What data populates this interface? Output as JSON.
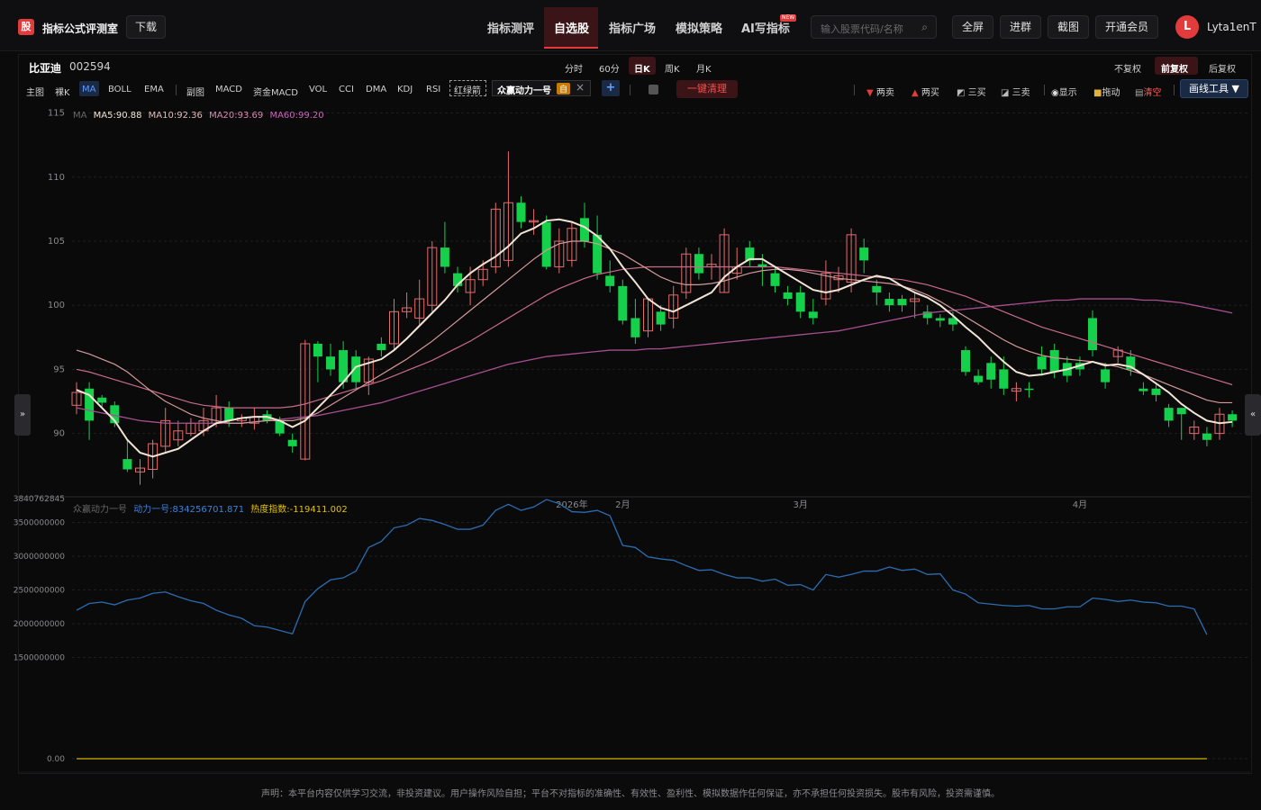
{
  "header": {
    "logo_glyph": "股",
    "logo_title": "指标公式评测室",
    "download": "下载",
    "nav": [
      "指标测评",
      "自选股",
      "指标广场",
      "模拟策略",
      "AI写指标"
    ],
    "nav_active": "自选股",
    "new_badge": "NEW",
    "search_placeholder": "输入股票代码/名称",
    "buttons": [
      "全屏",
      "进群",
      "截图",
      "开通会员"
    ],
    "avatar_letter": "L",
    "username": "Lyta1enT"
  },
  "stock": {
    "name": "比亚迪",
    "code": "002594"
  },
  "periods": [
    "分时",
    "60分",
    "日K",
    "周K",
    "月K"
  ],
  "period_active": "日K",
  "adjust": [
    "不复权",
    "前复权",
    "后复权"
  ],
  "adjust_active": "前复权",
  "indicator_bar": {
    "main_label": "主图",
    "main_items": [
      "裸K",
      "MA",
      "BOLL",
      "EMA"
    ],
    "active_item": "MA",
    "sub_label": "副图",
    "sub_items": [
      "MACD",
      "资金MACD",
      "VOL",
      "CCI",
      "DMA",
      "KDJ",
      "RSI"
    ],
    "hongluzhan": "红绿箭",
    "custom_indicator": "众赢动力一号",
    "custom_tag": "自",
    "clean_button": "一键清理"
  },
  "tools": {
    "items": [
      {
        "label": "两卖",
        "icon": "down-triangle-icon"
      },
      {
        "label": "两买",
        "icon": "up-triangle-icon"
      },
      {
        "label": "三买",
        "icon": "flag-icon"
      },
      {
        "label": "三卖",
        "icon": "flag-icon"
      },
      {
        "label": "显示",
        "icon": "eye-icon"
      },
      {
        "label": "拖动",
        "icon": "lock-icon"
      },
      {
        "label": "清空",
        "icon": "trash-icon"
      }
    ],
    "draw_button": "画线工具 ▼"
  },
  "ma_legend": {
    "label": "MA",
    "ma5": "MA5:90.88",
    "ma10": "MA10:92.36",
    "ma20": "MA20:93.69",
    "ma60": "MA60:99.20"
  },
  "sub_legend": {
    "label": "众赢动力一号",
    "line": "动力一号:834256701.871",
    "heat": "热度指数:-119411.002"
  },
  "chart_data": [
    {
      "type": "candlestick",
      "title": "",
      "y_ticks": [
        115,
        110,
        105,
        100,
        95,
        90
      ],
      "ylim": [
        85.2,
        115.6
      ],
      "x_labels": [
        {
          "label": "2026年",
          "index": 39
        },
        {
          "label": "2月",
          "index": 43
        },
        {
          "label": "3月",
          "index": 57
        },
        {
          "label": "4月",
          "index": 79
        }
      ],
      "candles": [
        [
          92.2,
          93.2,
          94.0,
          91.5
        ],
        [
          93.5,
          91.0,
          94.0,
          89.5
        ],
        [
          92.8,
          92.4,
          93.0,
          92.0
        ],
        [
          92.2,
          90.8,
          92.5,
          90.5
        ],
        [
          88.0,
          87.2,
          89.5,
          87.0
        ],
        [
          87.0,
          87.3,
          88.0,
          86.0
        ],
        [
          87.2,
          89.2,
          89.5,
          86.5
        ],
        [
          89.0,
          91.0,
          92.0,
          88.5
        ],
        [
          89.5,
          90.2,
          91.0,
          89.0
        ],
        [
          90.0,
          90.8,
          91.2,
          89.8
        ],
        [
          90.2,
          91.0,
          92.0,
          89.8
        ],
        [
          90.8,
          92.0,
          93.0,
          90.5
        ],
        [
          92.0,
          91.0,
          92.5,
          90.5
        ],
        [
          91.0,
          91.2,
          91.5,
          90.5
        ],
        [
          90.8,
          91.3,
          92.0,
          90.3
        ],
        [
          91.5,
          91.0,
          91.8,
          90.8
        ],
        [
          91.0,
          90.0,
          91.3,
          89.8
        ],
        [
          89.5,
          89.0,
          90.0,
          88.5
        ],
        [
          88.0,
          97.0,
          97.3,
          87.9
        ],
        [
          97.0,
          96.0,
          97.2,
          94.0
        ],
        [
          96.0,
          95.0,
          97.0,
          94.5
        ],
        [
          96.5,
          94.0,
          97.2,
          93.5
        ],
        [
          96.0,
          94.0,
          96.5,
          93.5
        ],
        [
          94.0,
          95.8,
          96.0,
          93.0
        ],
        [
          97.0,
          96.5,
          97.5,
          96.0
        ],
        [
          97.0,
          99.5,
          100.5,
          96.5
        ],
        [
          99.5,
          99.8,
          101.0,
          99.0
        ],
        [
          99.0,
          100.5,
          102.0,
          98.5
        ],
        [
          100.0,
          104.5,
          105.0,
          99.5
        ],
        [
          104.5,
          103.0,
          106.5,
          102.5
        ],
        [
          102.5,
          101.5,
          103.0,
          101.0
        ],
        [
          101.0,
          102.0,
          103.0,
          100.0
        ],
        [
          102.0,
          102.8,
          103.5,
          101.5
        ],
        [
          103.0,
          107.5,
          108.0,
          102.5
        ],
        [
          103.5,
          108.0,
          112.0,
          103.0
        ],
        [
          108.0,
          106.5,
          108.5,
          106.0
        ],
        [
          106.5,
          106.6,
          107.5,
          105.5
        ],
        [
          106.5,
          103.0,
          107.0,
          102.8
        ],
        [
          103.0,
          105.0,
          106.0,
          102.5
        ],
        [
          103.5,
          106.0,
          106.5,
          103.0
        ],
        [
          106.8,
          105.0,
          108.0,
          104.5
        ],
        [
          105.5,
          102.5,
          107.0,
          102.0
        ],
        [
          102.3,
          101.5,
          103.5,
          101.0
        ],
        [
          101.5,
          98.8,
          102.0,
          98.5
        ],
        [
          99.0,
          97.5,
          100.5,
          97.0
        ],
        [
          98.0,
          100.5,
          100.5,
          97.5
        ],
        [
          99.5,
          98.5,
          100.0,
          98.0
        ],
        [
          99.0,
          100.8,
          101.5,
          98.2
        ],
        [
          101.0,
          104.0,
          104.5,
          100.5
        ],
        [
          104.0,
          102.5,
          104.5,
          102.0
        ],
        [
          103.0,
          103.2,
          104.0,
          102.0
        ],
        [
          101.0,
          105.5,
          106.0,
          101.0
        ],
        [
          102.5,
          103.0,
          104.5,
          102.0
        ],
        [
          104.5,
          103.5,
          105.0,
          103.0
        ],
        [
          103.2,
          103.0,
          104.0,
          101.5
        ],
        [
          102.5,
          101.5,
          103.0,
          101.0
        ],
        [
          101.0,
          100.5,
          101.5,
          100.0
        ],
        [
          101.0,
          99.5,
          101.5,
          99.0
        ],
        [
          99.5,
          99.0,
          100.5,
          98.5
        ],
        [
          100.5,
          102.5,
          103.5,
          100.0
        ],
        [
          102.0,
          102.3,
          103.0,
          101.0
        ],
        [
          101.8,
          105.5,
          106.0,
          101.0
        ],
        [
          104.5,
          103.5,
          105.2,
          102.5
        ],
        [
          101.5,
          101.0,
          102.0,
          100.0
        ],
        [
          100.5,
          100.0,
          101.0,
          99.5
        ],
        [
          100.5,
          100.0,
          100.8,
          99.5
        ],
        [
          100.3,
          100.5,
          101.0,
          99.0
        ],
        [
          99.5,
          99.0,
          100.0,
          98.5
        ],
        [
          99.0,
          98.8,
          99.3,
          98.3
        ],
        [
          99.0,
          98.5,
          99.5,
          98.0
        ],
        [
          96.5,
          94.8,
          96.8,
          94.5
        ],
        [
          94.5,
          94.0,
          95.0,
          93.8
        ],
        [
          95.5,
          94.2,
          96.0,
          93.5
        ],
        [
          95.0,
          93.5,
          96.0,
          93.0
        ],
        [
          93.3,
          93.5,
          94.0,
          92.5
        ],
        [
          93.5,
          93.4,
          94.0,
          92.8
        ],
        [
          96.0,
          95.0,
          96.8,
          94.5
        ],
        [
          96.5,
          94.8,
          97.0,
          94.3
        ],
        [
          95.5,
          94.5,
          96.0,
          94.0
        ],
        [
          95.5,
          95.0,
          96.0,
          94.5
        ],
        [
          99.0,
          96.5,
          99.6,
          96.0
        ],
        [
          95.0,
          94.0,
          95.5,
          93.5
        ],
        [
          96.0,
          96.5,
          96.8,
          95.5
        ],
        [
          96.0,
          95.0,
          96.5,
          94.5
        ],
        [
          93.5,
          93.3,
          94.0,
          93.0
        ],
        [
          93.5,
          93.0,
          93.8,
          92.5
        ],
        [
          92.0,
          91.0,
          92.3,
          90.5
        ],
        [
          92.0,
          91.5,
          92.0,
          89.5
        ],
        [
          90.0,
          90.5,
          91.0,
          89.5
        ],
        [
          90.0,
          89.5,
          90.5,
          89.0
        ],
        [
          90.0,
          91.5,
          92.0,
          89.5
        ],
        [
          91.5,
          91.0,
          91.8,
          90.5
        ]
      ],
      "ma5": [
        93.4,
        93.0,
        92.0,
        91.0,
        89.5,
        88.5,
        88.2,
        88.5,
        88.8,
        89.5,
        90.2,
        90.8,
        91.0,
        91.2,
        91.3,
        91.3,
        91.0,
        90.5,
        91.0,
        92.0,
        93.0,
        94.0,
        95.2,
        95.5,
        95.8,
        96.5,
        97.4,
        98.4,
        99.4,
        100.4,
        101.6,
        102.5,
        103.2,
        103.8,
        104.6,
        105.6,
        106.0,
        106.6,
        106.7,
        106.5,
        106.1,
        105.4,
        104.4,
        103.0,
        101.8,
        100.5,
        99.8,
        99.5,
        100.0,
        100.5,
        101.0,
        102.2,
        103.0,
        103.6,
        103.6,
        103.0,
        102.4,
        101.8,
        101.2,
        101.0,
        101.2,
        101.6,
        102.0,
        102.3,
        102.1,
        101.5,
        101.0,
        100.6,
        100.0,
        99.2,
        98.3,
        97.5,
        96.5,
        95.6,
        94.8,
        94.5,
        94.6,
        94.8,
        95.0,
        95.3,
        95.6,
        95.3,
        95.4,
        95.2,
        94.6,
        93.9,
        93.2,
        92.3,
        91.6,
        91.0,
        90.8,
        90.9
      ],
      "ma10": [
        96.5,
        96.2,
        95.8,
        95.4,
        94.8,
        94.0,
        93.2,
        92.5,
        92.0,
        91.5,
        91.2,
        91.0,
        90.8,
        90.8,
        90.9,
        91.0,
        91.0,
        91.0,
        91.2,
        91.6,
        92.2,
        92.8,
        93.4,
        94.0,
        94.6,
        95.2,
        95.8,
        96.5,
        97.2,
        98.0,
        98.8,
        99.6,
        100.4,
        101.2,
        102.0,
        102.8,
        103.6,
        104.3,
        104.8,
        105.0,
        105.0,
        104.8,
        104.4,
        104.0,
        103.4,
        102.8,
        102.2,
        101.8,
        101.6,
        101.6,
        101.7,
        101.9,
        102.2,
        102.5,
        102.7,
        102.8,
        102.8,
        102.7,
        102.5,
        102.3,
        102.1,
        102.0,
        101.9,
        101.8,
        101.7,
        101.5,
        101.2,
        100.8,
        100.3,
        99.7,
        99.1,
        98.5,
        97.9,
        97.3,
        96.8,
        96.4,
        96.1,
        95.9,
        95.8,
        95.7,
        95.6,
        95.4,
        95.2,
        94.9,
        94.6,
        94.2,
        93.8,
        93.4,
        93.0,
        92.6,
        92.4,
        92.4
      ],
      "ma20": [
        95.0,
        94.8,
        94.5,
        94.2,
        93.9,
        93.6,
        93.3,
        93.0,
        92.7,
        92.4,
        92.2,
        92.1,
        92.0,
        92.0,
        92.0,
        92.0,
        92.0,
        92.1,
        92.3,
        92.6,
        92.9,
        93.2,
        93.5,
        93.8,
        94.1,
        94.5,
        94.9,
        95.3,
        95.7,
        96.2,
        96.7,
        97.2,
        97.8,
        98.4,
        99.0,
        99.6,
        100.2,
        100.8,
        101.3,
        101.7,
        102.1,
        102.4,
        102.6,
        102.8,
        102.9,
        103.0,
        103.0,
        103.0,
        103.0,
        103.0,
        103.0,
        103.0,
        103.0,
        103.0,
        103.0,
        103.0,
        102.9,
        102.8,
        102.7,
        102.6,
        102.5,
        102.4,
        102.3,
        102.2,
        102.1,
        102.0,
        101.8,
        101.6,
        101.3,
        101.0,
        100.7,
        100.3,
        99.9,
        99.5,
        99.1,
        98.7,
        98.3,
        98.0,
        97.7,
        97.4,
        97.1,
        96.8,
        96.5,
        96.2,
        95.9,
        95.6,
        95.3,
        95.0,
        94.7,
        94.4,
        94.1,
        93.8
      ],
      "ma60": [
        92.0,
        91.8,
        91.6,
        91.4,
        91.2,
        91.0,
        90.9,
        90.8,
        90.8,
        90.8,
        90.8,
        90.8,
        90.8,
        90.8,
        90.9,
        91.0,
        91.1,
        91.2,
        91.3,
        91.4,
        91.6,
        91.8,
        92.0,
        92.2,
        92.4,
        92.7,
        93.0,
        93.3,
        93.6,
        93.9,
        94.2,
        94.5,
        94.8,
        95.1,
        95.4,
        95.6,
        95.8,
        96.0,
        96.1,
        96.2,
        96.3,
        96.4,
        96.5,
        96.5,
        96.5,
        96.6,
        96.6,
        96.7,
        96.8,
        96.9,
        97.0,
        97.1,
        97.2,
        97.3,
        97.4,
        97.5,
        97.6,
        97.7,
        97.8,
        97.9,
        98.0,
        98.2,
        98.4,
        98.6,
        98.8,
        99.0,
        99.2,
        99.4,
        99.5,
        99.6,
        99.7,
        99.8,
        99.9,
        100.0,
        100.1,
        100.2,
        100.3,
        100.4,
        100.4,
        100.5,
        100.5,
        100.5,
        100.5,
        100.5,
        100.4,
        100.4,
        100.3,
        100.2,
        100.0,
        99.8,
        99.6,
        99.4
      ]
    },
    {
      "type": "line",
      "title": "",
      "y_ticks": [
        "3840762845",
        "3500000000",
        "3000000000",
        "2500000000",
        "2000000000",
        "1500000000",
        "0.00"
      ],
      "ylim": [
        0,
        3840762845
      ],
      "series": [
        {
          "color": "#2b6cb0",
          "values": [
            2200000000,
            2300000000,
            2320000000,
            2280000000,
            2350000000,
            2380000000,
            2450000000,
            2470000000,
            2400000000,
            2340000000,
            2300000000,
            2200000000,
            2130000000,
            2080000000,
            1970000000,
            1950000000,
            1900000000,
            1850000000,
            2330000000,
            2520000000,
            2650000000,
            2680000000,
            2780000000,
            3130000000,
            3220000000,
            3420000000,
            3460000000,
            3560000000,
            3530000000,
            3470000000,
            3400000000,
            3400000000,
            3460000000,
            3680000000,
            3770000000,
            3680000000,
            3730000000,
            3840000000,
            3780000000,
            3660000000,
            3650000000,
            3680000000,
            3600000000,
            3160000000,
            3130000000,
            2990000000,
            2960000000,
            2940000000,
            2860000000,
            2790000000,
            2800000000,
            2730000000,
            2680000000,
            2680000000,
            2630000000,
            2660000000,
            2570000000,
            2580000000,
            2500000000,
            2730000000,
            2690000000,
            2730000000,
            2780000000,
            2780000000,
            2840000000,
            2790000000,
            2810000000,
            2730000000,
            2740000000,
            2500000000,
            2440000000,
            2310000000,
            2290000000,
            2270000000,
            2260000000,
            2270000000,
            2220000000,
            2220000000,
            2250000000,
            2250000000,
            2380000000,
            2360000000,
            2330000000,
            2350000000,
            2320000000,
            2310000000,
            2260000000,
            2260000000,
            2220000000,
            1840000000
          ]
        },
        {
          "color": "#d4b400",
          "values": [
            0,
            0,
            0,
            0,
            0,
            0,
            0,
            0,
            0,
            0,
            0,
            0,
            0,
            0,
            0,
            0,
            0,
            0,
            0,
            0,
            0,
            0,
            0,
            0,
            0,
            0,
            0,
            0,
            0,
            0,
            0,
            0,
            0,
            0,
            0,
            0,
            0,
            0,
            0,
            0,
            0,
            0,
            0,
            0,
            0,
            0,
            0,
            0,
            0,
            0,
            0,
            0,
            0,
            0,
            0,
            0,
            0,
            0,
            0,
            0,
            0,
            0,
            0,
            0,
            0,
            0,
            0,
            0,
            0,
            0,
            0,
            0,
            0,
            0,
            0,
            0,
            0,
            0,
            0,
            0,
            0,
            0,
            0,
            0,
            0,
            0,
            0,
            0,
            0,
            0
          ]
        }
      ]
    }
  ],
  "side": {
    "left_arrow": "»",
    "right_arrow": "«"
  },
  "footer": "声明：本平台内容仅供学习交流，非投资建议。用户操作风险自担；平台不对指标的准确性、有效性、盈利性、模拟数据作任何保证，亦不承担任何投资损失。股市有风险，投资需谨慎。"
}
